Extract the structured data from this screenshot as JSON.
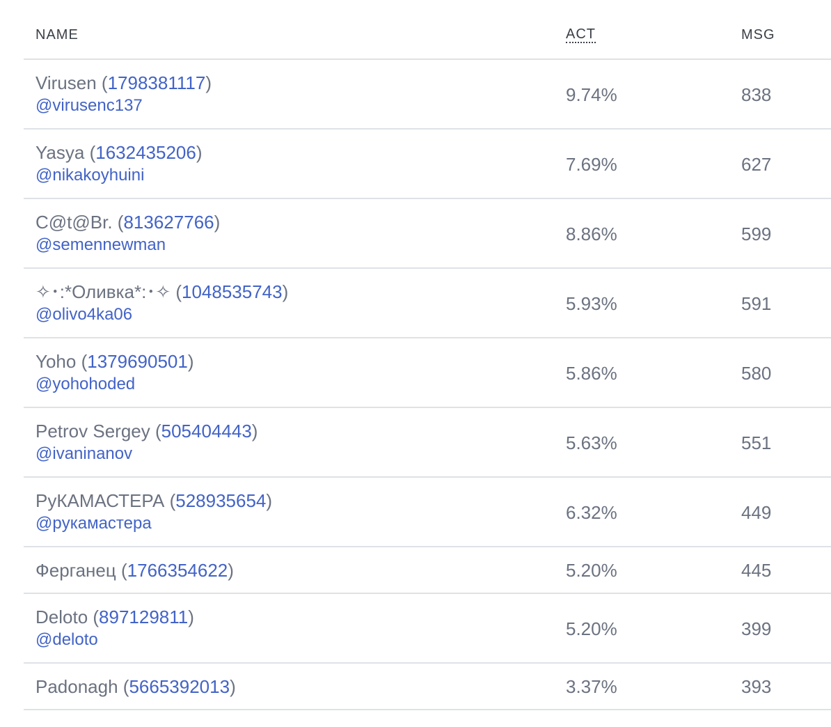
{
  "table": {
    "headers": {
      "name": "NAME",
      "act": "ACT",
      "msg": "MSG"
    },
    "rows": [
      {
        "name": "Virusen",
        "id": "1798381117",
        "username": "@virusenc137",
        "act": "9.74%",
        "msg": "838"
      },
      {
        "name": "Yasya",
        "id": "1632435206",
        "username": "@nikakoyhuini",
        "act": "7.69%",
        "msg": "627"
      },
      {
        "name": "C@t@Br.",
        "id": "813627766",
        "username": "@semennewman",
        "act": "8.86%",
        "msg": "599"
      },
      {
        "name": "✧･:*Оливка*:･✧",
        "id": "1048535743",
        "username": "@olivo4ka06",
        "act": "5.93%",
        "msg": "591"
      },
      {
        "name": "Yoho",
        "id": "1379690501",
        "username": "@yohohoded",
        "act": "5.86%",
        "msg": "580"
      },
      {
        "name": "Petrov Sergey",
        "id": "505404443",
        "username": "@ivaninanov",
        "act": "5.63%",
        "msg": "551"
      },
      {
        "name": "PyКАМАСТЕРА",
        "id": "528935654",
        "username": "@pyкамастера",
        "act": "6.32%",
        "msg": "449"
      },
      {
        "name": "Ферганец",
        "id": "1766354622",
        "username": "",
        "act": "5.20%",
        "msg": "445"
      },
      {
        "name": "Deloto",
        "id": "897129811",
        "username": "@deloto",
        "act": "5.20%",
        "msg": "399"
      },
      {
        "name": "Padonagh",
        "id": "5665392013",
        "username": "",
        "act": "3.37%",
        "msg": "393"
      }
    ]
  }
}
